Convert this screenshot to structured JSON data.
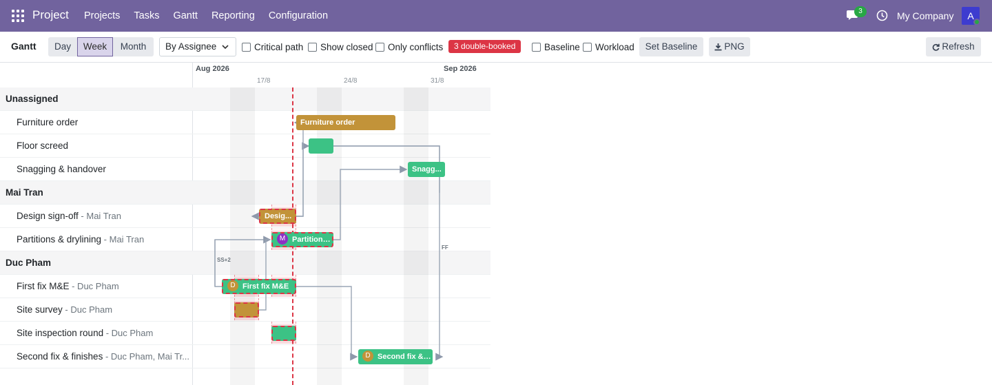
{
  "navbar": {
    "brand": "Project",
    "menu": [
      "Projects",
      "Tasks",
      "Gantt",
      "Reporting",
      "Configuration"
    ],
    "chat_count": "3",
    "company": "My Company",
    "avatar_letter": "A",
    "bg_color": "#71639e"
  },
  "toolbar": {
    "title": "Gantt",
    "scale_buttons": [
      "Day",
      "Week",
      "Month"
    ],
    "active_scale": "Week",
    "group_by": "By Assignee",
    "checkboxes": [
      "Critical path",
      "Show closed",
      "Only conflicts"
    ],
    "conflict_badge": "3 double-booked",
    "checkboxes2": [
      "Baseline",
      "Workload"
    ],
    "set_baseline": "Set Baseline",
    "png": "PNG",
    "refresh": "Refresh"
  },
  "timeline": {
    "months": [
      "Aug 2026",
      "Sep 2026"
    ],
    "weeks": [
      "17/8",
      "24/8",
      "31/8"
    ]
  },
  "rows": [
    {
      "type": "group",
      "label": "Unassigned"
    },
    {
      "type": "task",
      "label": "Furniture order",
      "assignee": ""
    },
    {
      "type": "task",
      "label": "Floor screed",
      "assignee": ""
    },
    {
      "type": "task",
      "label": "Snagging & handover",
      "assignee": ""
    },
    {
      "type": "group",
      "label": "Mai Tran"
    },
    {
      "type": "task",
      "label": "Design sign-off",
      "assignee": " - Mai Tran"
    },
    {
      "type": "task",
      "label": "Partitions & drylining",
      "assignee": " - Mai Tran"
    },
    {
      "type": "group",
      "label": "Duc Pham"
    },
    {
      "type": "task",
      "label": "First fix M&E",
      "assignee": " - Duc Pham"
    },
    {
      "type": "task",
      "label": "Site survey",
      "assignee": " - Duc Pham"
    },
    {
      "type": "task",
      "label": "Site inspection round",
      "assignee": " - Duc Pham"
    },
    {
      "type": "task",
      "label": "Second fix & finishes",
      "assignee": " - Duc Pham, Mai Tr..."
    }
  ],
  "bars": {
    "furniture": "Furniture order",
    "snagging": "Snagg...",
    "design": "Desig...",
    "partitions": "Partitions ...",
    "partitions_avatar": "M",
    "firstfix": "First fix M&E",
    "firstfix_avatar": "D",
    "secondfix": "Second fix & f...",
    "secondfix_avatar": "D"
  },
  "dep_labels": {
    "ss": "SS+2",
    "ff": "FF"
  },
  "colors": {
    "task_orange": "#c29339",
    "task_green": "#3cc285",
    "conflict_red": "#dc3545",
    "today": "#dc3545"
  }
}
